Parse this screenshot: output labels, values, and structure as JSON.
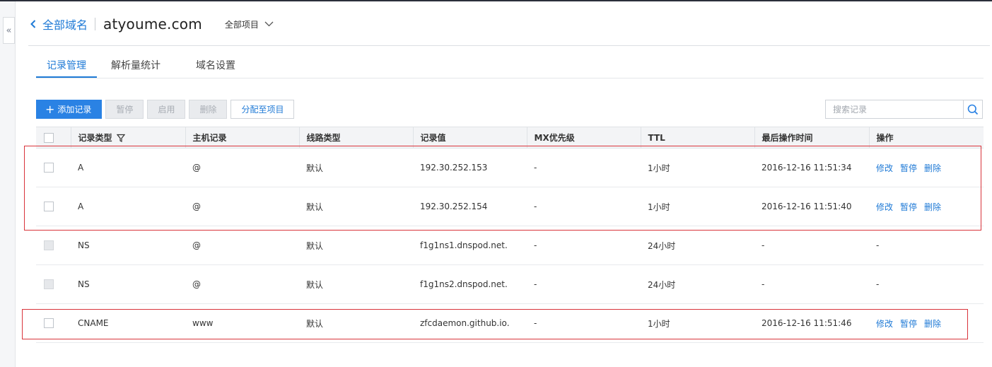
{
  "header": {
    "back_label": "全部域名",
    "domain": "atyoume.com",
    "project_select": "全部项目"
  },
  "tabs": [
    {
      "label": "记录管理",
      "active": true
    },
    {
      "label": "解析量统计",
      "active": false
    },
    {
      "label": "域名设置",
      "active": false
    }
  ],
  "toolbar": {
    "add": "添加记录",
    "pause": "暂停",
    "enable": "启用",
    "delete": "删除",
    "assign": "分配至项目"
  },
  "search": {
    "placeholder": "搜索记录"
  },
  "table": {
    "headers": [
      "记录类型",
      "主机记录",
      "线路类型",
      "记录值",
      "MX优先级",
      "TTL",
      "最后操作时间",
      "操作"
    ],
    "rows": [
      {
        "type": "A",
        "host": "@",
        "line": "默认",
        "value": "192.30.252.153",
        "mx": "-",
        "ttl": "1小时",
        "time": "2016-12-16 11:51:34",
        "ops": [
          "修改",
          "暂停",
          "删除"
        ],
        "disabled": false
      },
      {
        "type": "A",
        "host": "@",
        "line": "默认",
        "value": "192.30.252.154",
        "mx": "-",
        "ttl": "1小时",
        "time": "2016-12-16 11:51:40",
        "ops": [
          "修改",
          "暂停",
          "删除"
        ],
        "disabled": false
      },
      {
        "type": "NS",
        "host": "@",
        "line": "默认",
        "value": "f1g1ns1.dnspod.net.",
        "mx": "-",
        "ttl": "24小时",
        "time": "-",
        "ops_text": "-",
        "disabled": true
      },
      {
        "type": "NS",
        "host": "@",
        "line": "默认",
        "value": "f1g1ns2.dnspod.net.",
        "mx": "-",
        "ttl": "24小时",
        "time": "-",
        "ops_text": "-",
        "disabled": true
      },
      {
        "type": "CNAME",
        "host": "www",
        "line": "默认",
        "value": "zfcdaemon.github.io.",
        "mx": "-",
        "ttl": "1小时",
        "time": "2016-12-16 11:51:46",
        "ops": [
          "修改",
          "暂停",
          "删除"
        ],
        "disabled": false
      }
    ]
  },
  "colors": {
    "accent": "#1f7ad6",
    "primary_button": "#2a82e4",
    "highlight_box": "#d9343b"
  }
}
